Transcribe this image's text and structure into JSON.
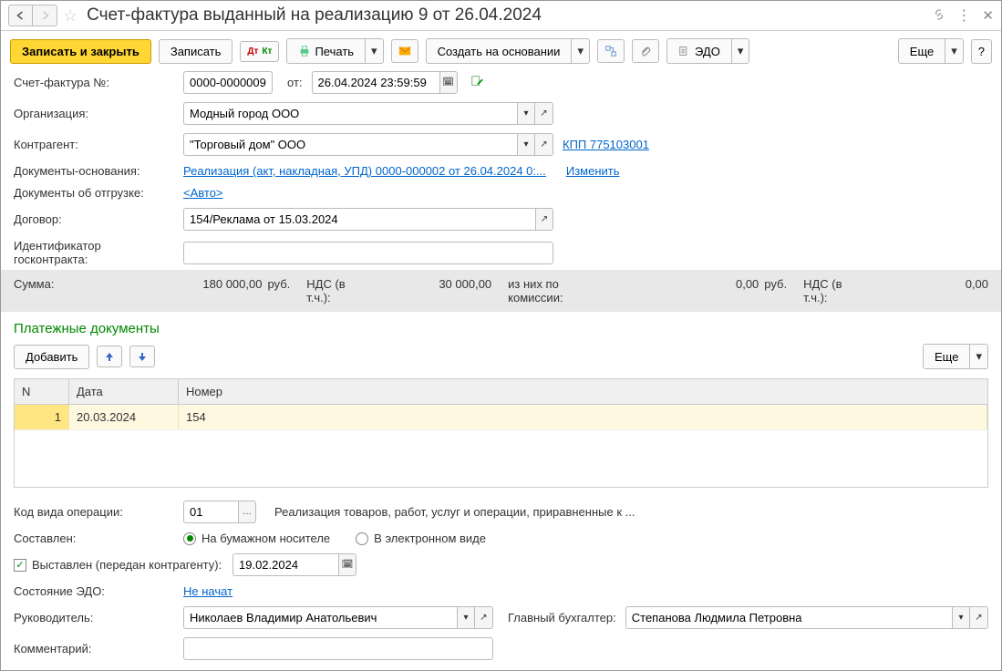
{
  "title": "Счет-фактура выданный на реализацию 9 от 26.04.2024",
  "toolbar": {
    "save_close": "Записать и закрыть",
    "save": "Записать",
    "print": "Печать",
    "create_based": "Создать на основании",
    "edo": "ЭДО",
    "more": "Еще"
  },
  "fields": {
    "invoice_no_lbl": "Счет-фактура №:",
    "invoice_no": "0000-0000009",
    "from_lbl": "от:",
    "date": "26.04.2024 23:59:59",
    "org_lbl": "Организация:",
    "org": "Модный город ООО",
    "contragent_lbl": "Контрагент:",
    "contragent": "\"Торговый дом\" ООО",
    "kpp": "КПП 775103001",
    "basis_lbl": "Документы-основания:",
    "basis": "Реализация (акт, накладная, УПД) 0000-000002 от 26.04.2024 0:...",
    "change": "Изменить",
    "shipdocs_lbl": "Документы об отгрузке:",
    "shipdocs": "<Авто>",
    "contract_lbl": "Договор:",
    "contract": "154/Реклама от 15.03.2024",
    "goscontract_lbl": "Идентификатор госконтракта:",
    "goscontract": ""
  },
  "summary": {
    "sum_lbl": "Сумма:",
    "sum": "180 000,00",
    "rub1": "руб.",
    "vat_lbl": "НДС (в т.ч.):",
    "vat": "30 000,00",
    "comm_lbl": "из них по комиссии:",
    "comm": "0,00",
    "rub2": "руб.",
    "vat2_lbl": "НДС (в т.ч.):",
    "vat2": "0,00"
  },
  "paydocs": {
    "title": "Платежные документы",
    "add": "Добавить",
    "more": "Еще",
    "col_n": "N",
    "col_date": "Дата",
    "col_num": "Номер",
    "rows": [
      {
        "n": "1",
        "date": "20.03.2024",
        "num": "154"
      }
    ]
  },
  "opcode": {
    "lbl": "Код вида операции:",
    "val": "01",
    "desc": "Реализация товаров, работ, услуг и операции, приравненные к ..."
  },
  "composed": {
    "lbl": "Составлен:",
    "paper": "На бумажном носителе",
    "electronic": "В электронном виде"
  },
  "issued": {
    "lbl": "Выставлен (передан контрагенту):",
    "date": "19.02.2024"
  },
  "edo_state": {
    "lbl": "Состояние ЭДО:",
    "val": "Не начат"
  },
  "head": {
    "lbl": "Руководитель:",
    "val": "Николаев Владимир Анатольевич"
  },
  "accountant": {
    "lbl": "Главный бухгалтер:",
    "val": "Степанова Людмила Петровна"
  },
  "comment": {
    "lbl": "Комментарий:",
    "val": ""
  }
}
